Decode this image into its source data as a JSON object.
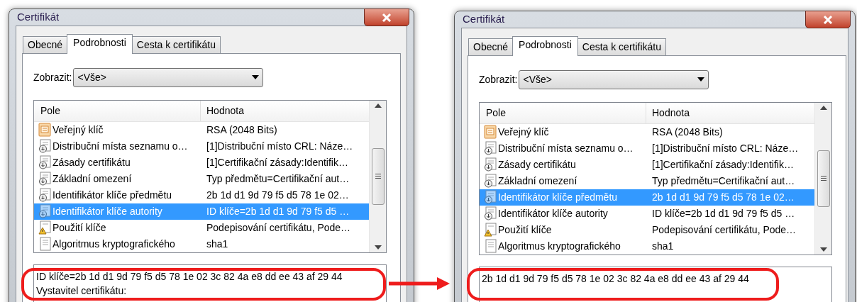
{
  "dialogs": [
    {
      "title": "Certifikát",
      "tabs": [
        {
          "label": "Obecné",
          "selected": false
        },
        {
          "label": "Podrobnosti",
          "selected": true
        },
        {
          "label": "Cesta k certifikátu",
          "selected": false
        }
      ],
      "show_label": "Zobrazit:",
      "show_value": "<Vše>",
      "columns": [
        "Pole",
        "Hodnota"
      ],
      "rows": [
        {
          "kind": "key",
          "field": "Veřejný klíč",
          "value": "RSA (2048 Bits)",
          "selected": false
        },
        {
          "kind": "extension",
          "field": "Distribuční místa seznamu o…",
          "value": "[1]Distribuční místo CRL: Náze…",
          "selected": false
        },
        {
          "kind": "extension",
          "field": "Zásady certifikátu",
          "value": "[1]Certifikační zásady:Identifik…",
          "selected": false
        },
        {
          "kind": "extension",
          "field": "Základní omezení",
          "value": "Typ předmětu=Certifikační aut…",
          "selected": false
        },
        {
          "kind": "extension",
          "field": "Identifikátor klíče předmětu",
          "value": "2b 1d d1 9d 79 f5 d5 78 1e 02…",
          "selected": false
        },
        {
          "kind": "extension",
          "field": "Identifikátor klíče autority",
          "value": "ID klíče=2b 1d d1 9d 79 f5 d5 …",
          "selected": true
        },
        {
          "kind": "warning",
          "field": "Použití klíče",
          "value": "Podepisování certifikátu, Pode…",
          "selected": false
        },
        {
          "kind": "document",
          "field": "Algoritmus kryptografického",
          "value": "sha1",
          "selected": false
        }
      ],
      "detail_lines": [
        "ID klíče=2b 1d d1 9d 79 f5 d5 78 1e 02 3c 82 4a e8 dd ee 43 af 29 44",
        "Vystavitel certifikátu:"
      ]
    },
    {
      "title": "Certifikát",
      "tabs": [
        {
          "label": "Obecné",
          "selected": false
        },
        {
          "label": "Podrobnosti",
          "selected": true
        },
        {
          "label": "Cesta k certifikátu",
          "selected": false
        }
      ],
      "show_label": "Zobrazit:",
      "show_value": "<Vše>",
      "columns": [
        "Pole",
        "Hodnota"
      ],
      "rows": [
        {
          "kind": "key",
          "field": "Veřejný klíč",
          "value": "RSA (2048 Bits)",
          "selected": false
        },
        {
          "kind": "extension",
          "field": "Distribuční místa seznamu o…",
          "value": "[1]Distribuční místo CRL: Náze…",
          "selected": false
        },
        {
          "kind": "extension",
          "field": "Zásady certifikátu",
          "value": "[1]Certifikační zásady:Identifik…",
          "selected": false
        },
        {
          "kind": "extension",
          "field": "Základní omezení",
          "value": "Typ předmětu=Certifikační aut…",
          "selected": false
        },
        {
          "kind": "extension",
          "field": "Identifikátor klíče předmětu",
          "value": "2b 1d d1 9d 79 f5 d5 78 1e 02…",
          "selected": true
        },
        {
          "kind": "extension",
          "field": "Identifikátor klíče autority",
          "value": "ID klíče=2b 1d d1 9d 79 f5 d5 …",
          "selected": false
        },
        {
          "kind": "warning",
          "field": "Použití klíče",
          "value": "Podepisování certifikátu, Pode…",
          "selected": false
        },
        {
          "kind": "document",
          "field": "Algoritmus kryptografického",
          "value": "sha1",
          "selected": false
        }
      ],
      "detail_lines": [
        "2b 1d d1 9d 79 f5 d5 78 1e 02 3c 82 4a e8 dd ee 43 af 29 44"
      ]
    }
  ]
}
